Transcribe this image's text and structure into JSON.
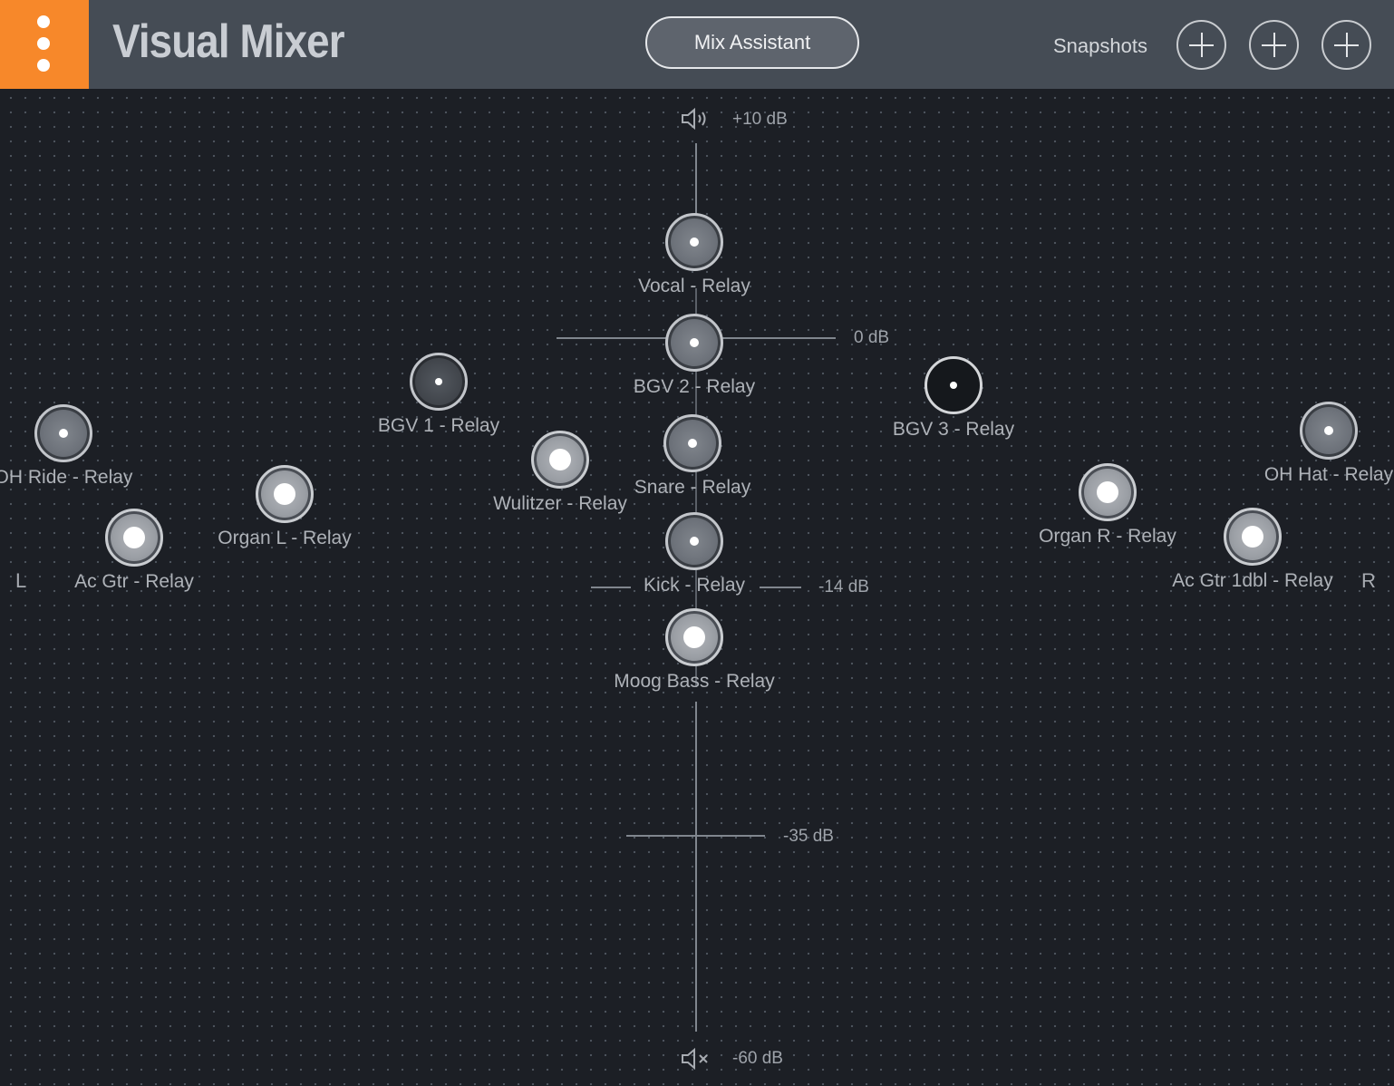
{
  "app": {
    "title": "Visual Mixer",
    "accent_color": "#f7882a",
    "menu_icon": "kebab-menu-icon"
  },
  "header": {
    "mix_assistant_label": "Mix Assistant",
    "snapshots_label": "Snapshots",
    "snapshot_add_icon": "plus-icon"
  },
  "scale": {
    "top_label": "+10 dB",
    "zero_label": "0 dB",
    "mid_label": "-14 dB",
    "low_label": "-35 dB",
    "bottom_label": "-60 dB",
    "left_label": "L",
    "right_label": "R",
    "top_icon": "speaker-volume-icon",
    "bottom_icon": "speaker-mute-icon"
  },
  "tracks": [
    {
      "name": "Vocal - Relay",
      "style": "gray"
    },
    {
      "name": "BGV 2 - Relay",
      "style": "gray"
    },
    {
      "name": "BGV 1 - Relay",
      "style": "dark"
    },
    {
      "name": "BGV 3 - Relay",
      "style": "black"
    },
    {
      "name": "OH Ride - Relay",
      "style": "gray"
    },
    {
      "name": "Organ L - Relay",
      "style": "bright"
    },
    {
      "name": "Wulitzer - Relay",
      "style": "bright"
    },
    {
      "name": "Snare - Relay",
      "style": "gray"
    },
    {
      "name": "Ac Gtr - Relay",
      "style": "bright"
    },
    {
      "name": "Kick - Relay",
      "style": "gray"
    },
    {
      "name": "Moog Bass - Relay",
      "style": "bright"
    },
    {
      "name": "Organ R - Relay",
      "style": "bright"
    },
    {
      "name": "OH Hat - Relay",
      "style": "gray"
    },
    {
      "name": "Ac Gtr 1dbl - Relay",
      "style": "bright"
    }
  ]
}
